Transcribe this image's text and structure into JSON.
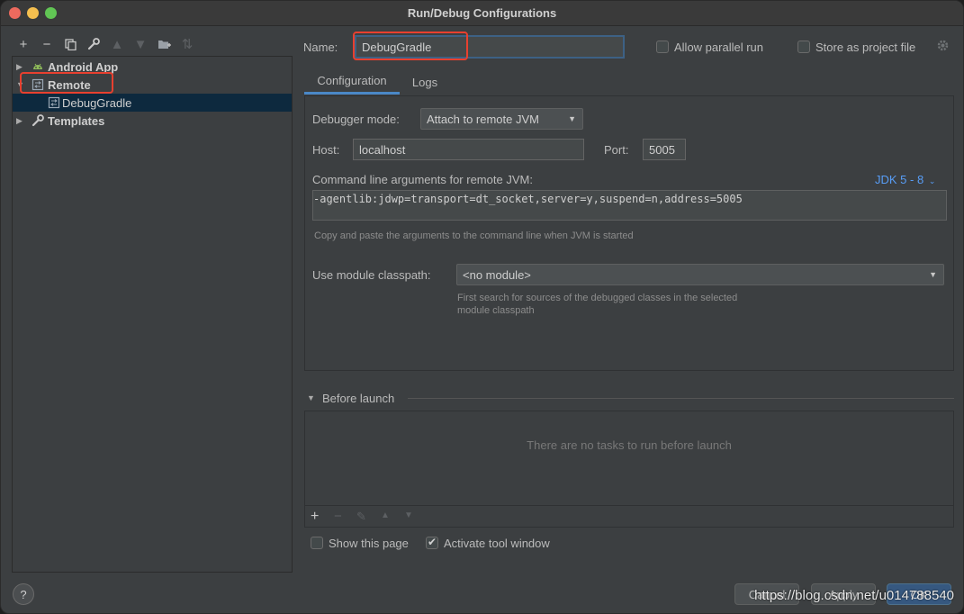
{
  "window": {
    "title": "Run/Debug Configurations"
  },
  "left_toolbar": {
    "icons": [
      "add-icon",
      "remove-icon",
      "copy-icon",
      "wrench-icon",
      "move-up-icon",
      "move-down-icon",
      "new-folder-icon",
      "sort-icon"
    ]
  },
  "tree": {
    "items": [
      {
        "label": "Android App",
        "icon": "android-icon",
        "expanded": false
      },
      {
        "label": "Remote",
        "icon": "remote-config-icon",
        "expanded": true
      },
      {
        "label": "DebugGradle",
        "icon": "remote-config-icon",
        "selected": true
      },
      {
        "label": "Templates",
        "icon": "wrench-icon",
        "expanded": false
      }
    ]
  },
  "header": {
    "name_label": "Name:",
    "name_value": "DebugGradle",
    "allow_parallel_label": "Allow parallel run",
    "allow_parallel_checked": false,
    "store_project_label": "Store as project file",
    "store_project_checked": false
  },
  "tabs": [
    {
      "label": "Configuration",
      "active": true
    },
    {
      "label": "Logs",
      "active": false
    }
  ],
  "configuration": {
    "debugger_mode_label": "Debugger mode:",
    "debugger_mode_value": "Attach to remote JVM",
    "host_label": "Host:",
    "host_value": "localhost",
    "port_label": "Port:",
    "port_value": "5005",
    "cmd_label": "Command line arguments for remote JVM:",
    "jdk_link": "JDK 5 - 8",
    "cmd_value": "-agentlib:jdwp=transport=dt_socket,server=y,suspend=n,address=5005",
    "cmd_hint": "Copy and paste the arguments to the command line when JVM is started",
    "module_label": "Use module classpath:",
    "module_value": "<no module>",
    "module_hint_line1": "First search for sources of the debugged classes in the selected",
    "module_hint_line2": "module classpath"
  },
  "before_launch": {
    "title": "Before launch",
    "empty_text": "There are no tasks to run before launch",
    "toolbar_icons": [
      "add-icon",
      "remove-icon",
      "edit-icon",
      "move-up-icon",
      "move-down-icon"
    ]
  },
  "options": {
    "show_page_label": "Show this page",
    "show_page_checked": false,
    "activate_tool_label": "Activate tool window",
    "activate_tool_checked": true
  },
  "footer": {
    "help_label": "?",
    "cancel_label": "Cancel",
    "apply_label": "Apply",
    "ok_label": "OK"
  },
  "watermark": "https://blog.csdn.net/u014788540",
  "colors": {
    "background": "#3c3f41",
    "selection": "#0d293e",
    "accent": "#4a88c7",
    "link": "#589df6",
    "highlight": "#e8402f"
  }
}
